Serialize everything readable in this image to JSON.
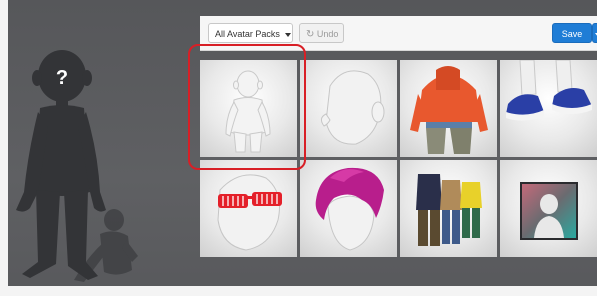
{
  "toolbar": {
    "packs_label": "All Avatar Packs",
    "undo_label": "Undo",
    "save_label": "Save"
  },
  "icons": {
    "unknown_avatar": "question-mark-icon",
    "undo": "undo-icon",
    "dropdown": "chevron-down-icon"
  },
  "colors": {
    "save_button": "#1f7dd6",
    "highlight_outline": "#d81f26",
    "background": "#5b5c5f"
  },
  "question_mark": "?",
  "gallery": {
    "items": [
      {
        "name": "Body"
      },
      {
        "name": "Head"
      },
      {
        "name": "Hoodie"
      },
      {
        "name": "Shoes"
      },
      {
        "name": "Glasses"
      },
      {
        "name": "Hair"
      },
      {
        "name": "Outfits"
      },
      {
        "name": "Photo"
      }
    ]
  }
}
